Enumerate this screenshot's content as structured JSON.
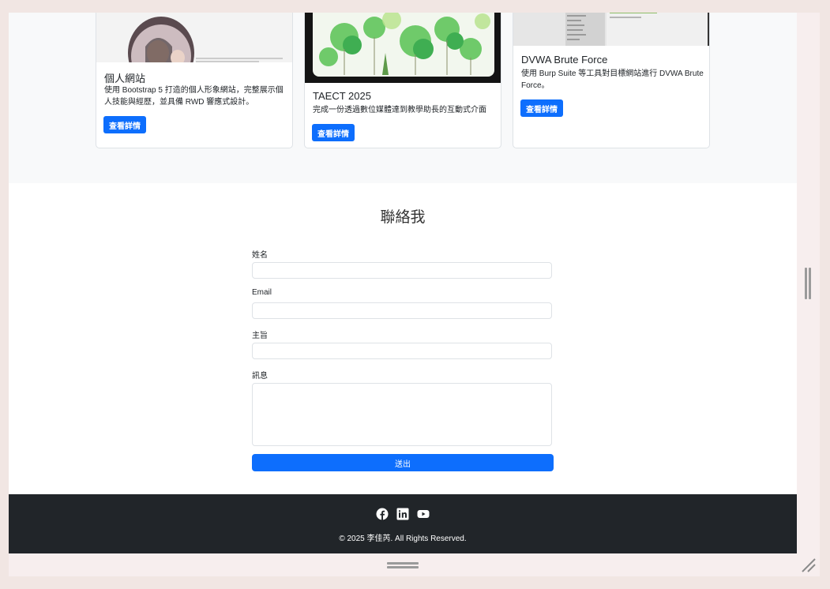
{
  "projects": [
    {
      "title": "個人網站",
      "description": "使用 Bootstrap 5 打造的個人形象網站，完整展示個人技能與經歷，並具備 RWD 響應式設計。",
      "button": "查看詳情"
    },
    {
      "title": "TAECT 2025",
      "description": "完成一份透過數位媒體達到教學助長的互動式介面",
      "button": "查看詳情"
    },
    {
      "title": "DVWA Brute Force",
      "description": "使用 Burp Suite 等工具對目標網站進行 DVWA Brute Force。",
      "button": "查看詳情"
    }
  ],
  "contact": {
    "title": "聯絡我",
    "fields": {
      "name_label": "姓名",
      "email_label": "Email",
      "subject_label": "主旨",
      "message_label": "訊息",
      "name_value": "",
      "email_value": "",
      "subject_value": "",
      "message_value": ""
    },
    "submit": "送出"
  },
  "footer": {
    "social_icons": [
      "facebook-icon",
      "linkedin-icon",
      "youtube-icon"
    ],
    "copyright": "© 2025 李佳芮. All Rights Reserved."
  },
  "colors": {
    "primary": "#0d6efd",
    "footer_bg": "#212529",
    "section_bg": "#f8f9fa",
    "outer_bg": "#f1e6e3"
  }
}
